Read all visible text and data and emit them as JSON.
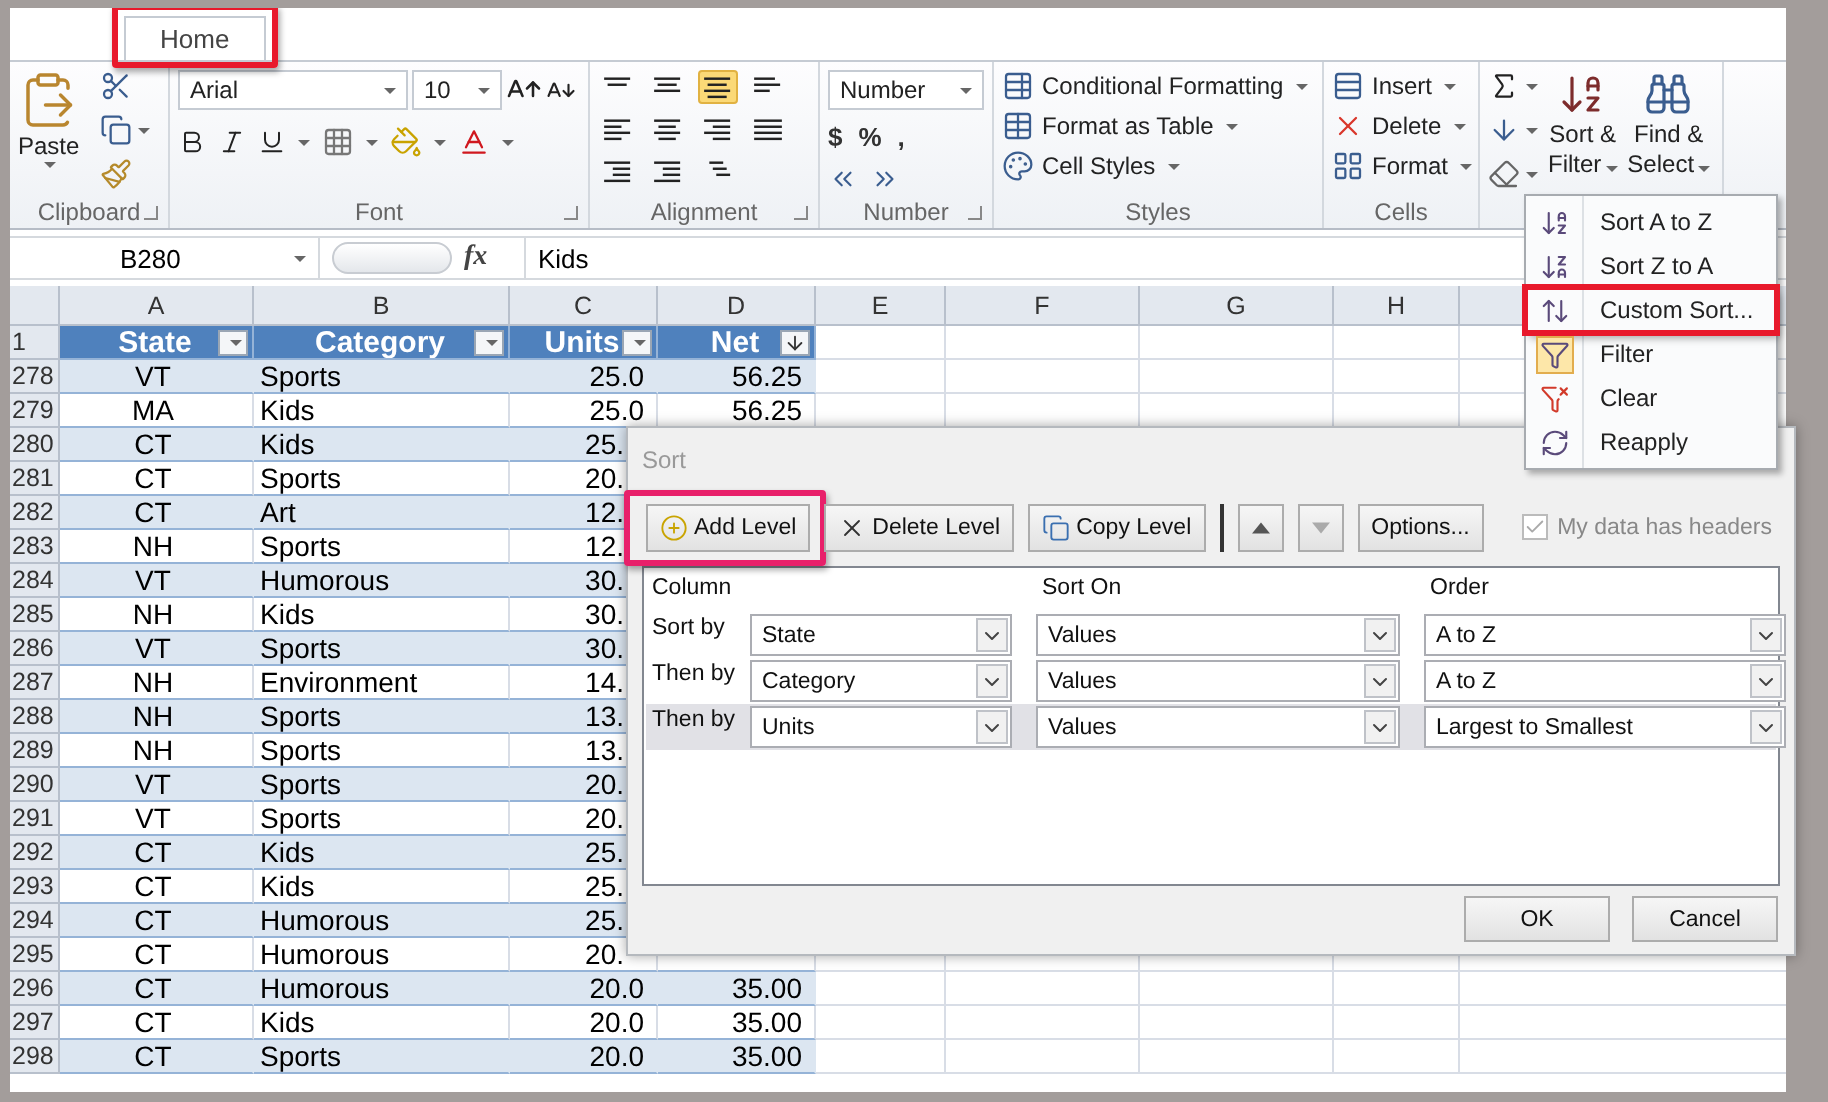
{
  "tabs": [
    {
      "label": "Home",
      "selected": true,
      "highlighted": true
    }
  ],
  "ribbon": {
    "clipboard": {
      "label": "Clipboard",
      "paste": "Paste"
    },
    "font": {
      "label": "Font",
      "name": "Arial",
      "size": "10"
    },
    "alignment": {
      "label": "Alignment",
      "vertical": [
        {
          "selected": false
        },
        {
          "selected": false
        },
        {
          "selected": true
        }
      ]
    },
    "number": {
      "label": "Number",
      "format": "Number",
      "symbols": [
        "$",
        "%",
        ","
      ]
    },
    "styles": {
      "label": "Styles",
      "items": [
        "Conditional Formatting",
        "Format as Table",
        "Cell Styles"
      ]
    },
    "cells": {
      "label": "Cells",
      "items": [
        "Insert",
        "Delete",
        "Format"
      ]
    },
    "editing": {
      "sort_filter": [
        "Sort &",
        "Filter"
      ],
      "find_select": [
        "Find &",
        "Select"
      ]
    }
  },
  "formula_bar": {
    "name_box": "B280",
    "function_button": "fx",
    "value": "Kids"
  },
  "sheet": {
    "columns": [
      "A",
      "B",
      "C",
      "D",
      "E",
      "F",
      "G",
      "H"
    ],
    "header_row": "1",
    "table_headers": [
      {
        "label": "State",
        "sorted": false
      },
      {
        "label": "Category",
        "sorted": false
      },
      {
        "label": "Units",
        "sorted": false
      },
      {
        "label": "Net",
        "sorted": true
      }
    ],
    "rows": [
      {
        "number": "278",
        "cells": [
          "VT",
          "Sports",
          "25.0",
          "56.25"
        ]
      },
      {
        "number": "279",
        "cells": [
          "MA",
          "Kids",
          "25.0",
          "56.25"
        ]
      },
      {
        "number": "280",
        "cells": [
          "CT",
          "Kids",
          "25."
        ]
      },
      {
        "number": "281",
        "cells": [
          "CT",
          "Sports",
          "20."
        ]
      },
      {
        "number": "282",
        "cells": [
          "CT",
          "Art",
          "12."
        ]
      },
      {
        "number": "283",
        "cells": [
          "NH",
          "Sports",
          "12."
        ]
      },
      {
        "number": "284",
        "cells": [
          "VT",
          "Humorous",
          "30."
        ]
      },
      {
        "number": "285",
        "cells": [
          "NH",
          "Kids",
          "30."
        ]
      },
      {
        "number": "286",
        "cells": [
          "VT",
          "Sports",
          "30."
        ]
      },
      {
        "number": "287",
        "cells": [
          "NH",
          "Environment",
          "14."
        ]
      },
      {
        "number": "288",
        "cells": [
          "NH",
          "Sports",
          "13."
        ]
      },
      {
        "number": "289",
        "cells": [
          "NH",
          "Sports",
          "13."
        ]
      },
      {
        "number": "290",
        "cells": [
          "VT",
          "Sports",
          "20."
        ]
      },
      {
        "number": "291",
        "cells": [
          "VT",
          "Sports",
          "20."
        ]
      },
      {
        "number": "292",
        "cells": [
          "CT",
          "Kids",
          "25."
        ]
      },
      {
        "number": "293",
        "cells": [
          "CT",
          "Kids",
          "25."
        ]
      },
      {
        "number": "294",
        "cells": [
          "CT",
          "Humorous",
          "25."
        ]
      },
      {
        "number": "295",
        "cells": [
          "CT",
          "Humorous",
          "20."
        ]
      },
      {
        "number": "296",
        "cells": [
          "CT",
          "Humorous",
          "20.0",
          "35.00"
        ]
      },
      {
        "number": "297",
        "cells": [
          "CT",
          "Kids",
          "20.0",
          "35.00"
        ]
      },
      {
        "number": "298",
        "cells": [
          "CT",
          "Sports",
          "20.0",
          "35.00"
        ]
      }
    ]
  },
  "sort_menu": {
    "items": [
      {
        "kind": "az",
        "label": "Sort A to Z",
        "on": false,
        "highlighted": false
      },
      {
        "kind": "za",
        "label": "Sort Z to A",
        "on": false,
        "highlighted": false
      },
      {
        "kind": "custom",
        "label": "Custom Sort...",
        "on": false,
        "highlighted": true
      },
      {
        "kind": "filter",
        "label": "Filter",
        "on": true,
        "highlighted": false
      },
      {
        "kind": "clear",
        "label": "Clear",
        "on": false,
        "highlighted": false
      },
      {
        "kind": "reapply",
        "label": "Reapply",
        "on": false,
        "highlighted": false
      }
    ]
  },
  "sort_dialog": {
    "title": "Sort",
    "toolbar": [
      {
        "kind": "add",
        "label": "Add Level",
        "highlighted": true
      },
      {
        "kind": "delete",
        "label": "Delete Level",
        "highlighted": false
      },
      {
        "kind": "copy",
        "label": "Copy Level",
        "highlighted": false
      },
      {
        "kind": "up",
        "highlighted": false
      },
      {
        "kind": "down",
        "highlighted": false
      },
      {
        "kind": "options",
        "label": "Options...",
        "highlighted": false
      }
    ],
    "headers_checkbox": {
      "label": "My data has headers",
      "checked": true,
      "disabled": true
    },
    "columns": [
      "Column",
      "Sort On",
      "Order"
    ],
    "levels": [
      {
        "label": "Sort by",
        "column": "State",
        "sort_on": "Values",
        "order": "A to Z",
        "selected": false
      },
      {
        "label": "Then by",
        "column": "Category",
        "sort_on": "Values",
        "order": "A to Z",
        "selected": false
      },
      {
        "label": "Then by",
        "column": "Units",
        "sort_on": "Values",
        "order": "Largest to Smallest",
        "selected": true
      }
    ],
    "buttons": [
      "OK",
      "Cancel"
    ]
  }
}
